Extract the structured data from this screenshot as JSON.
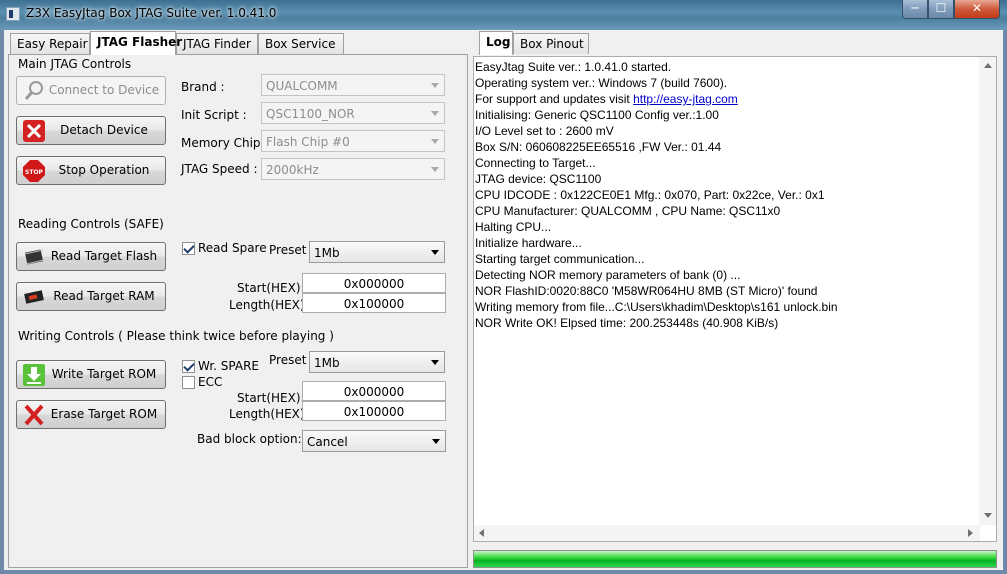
{
  "window": {
    "title": "Z3X EasyJtag Box JTAG Suite ver. 1.0.41.0",
    "minimize": "─",
    "maximize": "☐",
    "close": "✕"
  },
  "left_tabs": [
    "Easy Repair",
    "JTAG Flasher",
    "JTAG Finder",
    "Box Service"
  ],
  "right_tabs": [
    "Log",
    "Box Pinout"
  ],
  "main_controls": {
    "title": "Main JTAG Controls",
    "connect_label": "Connect to Device",
    "detach_label": "Detach Device",
    "stop_label": "Stop Operation",
    "stop_icon_text": "STOP",
    "brand_label": "Brand :",
    "brand_value": "QUALCOMM",
    "init_script_label": "Init Script :",
    "init_script_value": "QSC1100_NOR",
    "memory_chip_label": "Memory Chip:",
    "memory_chip_value": "Flash Chip #0",
    "jtag_speed_label": "JTAG Speed :",
    "jtag_speed_value": "2000kHz"
  },
  "reading": {
    "title": "Reading Controls (SAFE)",
    "read_flash_label": "Read Target Flash",
    "read_ram_label": "Read Target RAM",
    "read_spare_label": "Read Spare",
    "read_spare_checked": true,
    "preset_label": "Preset",
    "preset_value": "1Mb",
    "start_label": "Start(HEX):",
    "start_value": "0x000000",
    "length_label": "Length(HEX):",
    "length_value": "0x100000"
  },
  "writing": {
    "title": "Writing Controls ( Please think twice before playing )",
    "write_rom_label": "Write Target ROM",
    "erase_rom_label": "Erase Target ROM",
    "wr_spare_label": "Wr. SPARE",
    "wr_spare_checked": true,
    "ecc_label": "ECC",
    "ecc_checked": false,
    "preset_label": "Preset",
    "preset_value": "1Mb",
    "start_label": "Start(HEX):",
    "start_value": "0x000000",
    "length_label": "Length(HEX):",
    "length_value": "0x100000",
    "bad_block_label": "Bad block option:",
    "bad_block_value": "Cancel"
  },
  "log": {
    "lines": [
      "EasyJtag Suite ver.: 1.0.41.0 started.",
      "Operating system ver.: Windows 7 (build 7600).",
      "For support and updates visit ",
      "Initialising: Generic QSC1100 Config ver.:1.00",
      "I/O Level set to : 2600 mV",
      "Box S/N: 060608225EE65516 ,FW Ver.: 01.44",
      "Connecting to Target...",
      "JTAG device: QSC1100",
      "CPU IDCODE : 0x122CE0E1 Mfg.: 0x070, Part: 0x22ce, Ver.: 0x1",
      "CPU Manufacturer: QUALCOMM , CPU Name: QSC11x0",
      "Halting CPU...",
      "Initialize hardware...",
      "Starting target communication...",
      "Detecting NOR memory parameters of bank (0) ...",
      "NOR FlashID:0020:88C0 'M58WR064HU 8MB (ST Micro)' found",
      "Writing memory from file...C:\\Users\\khadim\\Desktop\\s161 unlock.bin",
      "NOR Write OK! Elpsed time: 200.253448s (40.908 KiB/s)"
    ],
    "support_link": "http://easy-jtag.com"
  },
  "progress": {
    "fraction": 1.0
  },
  "colors": {
    "progress_green": "#06b025",
    "link_blue": "#0000cc",
    "titlebar": "#4c7e9f"
  }
}
